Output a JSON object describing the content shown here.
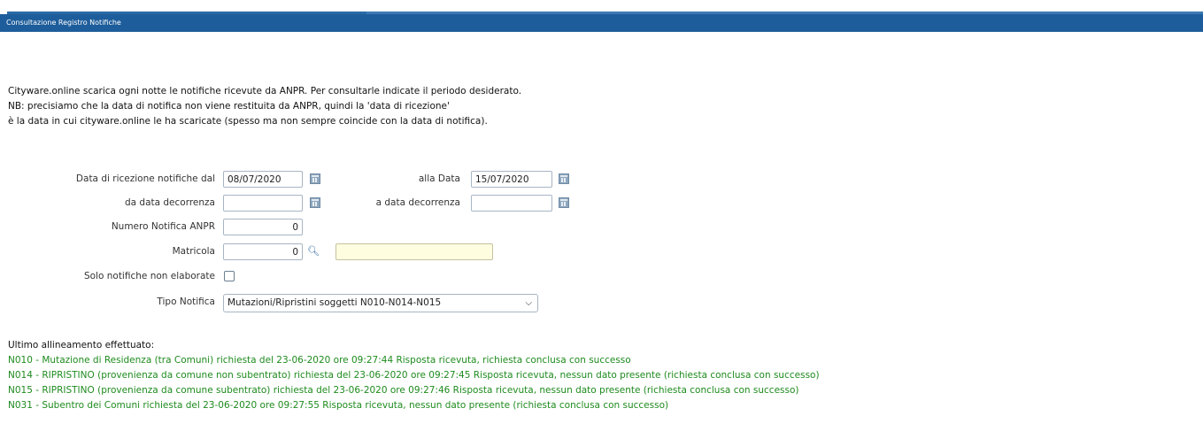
{
  "window": {
    "title": "Consultazione Registro Notifiche"
  },
  "intro": {
    "line1": "Cityware.online scarica ogni notte le notifiche ricevute da ANPR. Per consultarle indicate il periodo desiderato.",
    "line2": "NB: precisiamo che la data di notifica non viene restituita da ANPR, quindi la 'data di ricezione'",
    "line3": "è la data in cui cityware.online le ha scaricate (spesso ma non sempre coincide con la data di notifica)."
  },
  "form": {
    "data_ricezione_label": "Data di ricezione notifiche dal",
    "data_ricezione_value": "08/07/2020",
    "alla_data_label": "alla Data",
    "alla_data_value": "15/07/2020",
    "da_decorrenza_label": "da data decorrenza",
    "da_decorrenza_value": "",
    "a_decorrenza_label": "a data decorrenza",
    "a_decorrenza_value": "",
    "numero_notifica_label": "Numero Notifica ANPR",
    "numero_notifica_value": "0",
    "matricola_label": "Matricola",
    "matricola_value": "0",
    "matricola_desc_value": "",
    "solo_non_elaborate_label": "Solo notifiche non elaborate",
    "solo_non_elaborate_checked": false,
    "tipo_notifica_label": "Tipo Notifica",
    "tipo_notifica_value": "Mutazioni/Ripristini soggetti N010-N014-N015"
  },
  "status": {
    "heading": "Ultimo allineamento effettuato:",
    "lines": [
      "N010 - Mutazione di Residenza (tra Comuni) richiesta del 23-06-2020 ore 09:27:44 Risposta ricevuta, richiesta conclusa con successo",
      "N014 - RIPRISTINO (provenienza da comune non subentrato) richiesta del 23-06-2020 ore 09:27:45 Risposta ricevuta, nessun dato presente (richiesta conclusa con successo)",
      "N015 - RIPRISTINO (provenienza da comune subentrato) richiesta del 23-06-2020 ore 09:27:46 Risposta ricevuta, nessun dato presente (richiesta conclusa con successo)",
      "N031 - Subentro dei Comuni richiesta del 23-06-2020 ore 09:27:55 Risposta ricevuta, nessun dato presente (richiesta conclusa con successo)"
    ],
    "color": "#1e8b1e"
  },
  "colors": {
    "titlebar": "#1e5d9b"
  }
}
